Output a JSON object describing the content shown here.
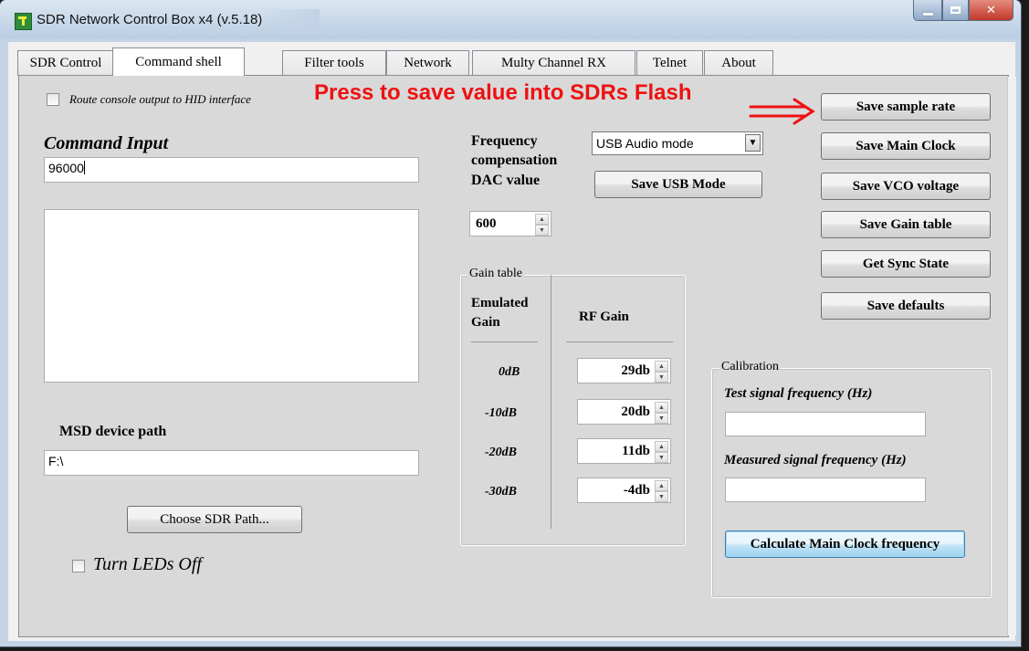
{
  "window": {
    "title": "SDR Network Control Box x4 (v.5.18)",
    "controls": {
      "minimize": "minimize-icon",
      "maximize": "maximize-icon",
      "close": "close-icon"
    }
  },
  "tabs": [
    {
      "label": "SDR Control",
      "active": false
    },
    {
      "label": "Command shell",
      "active": true
    },
    {
      "label": "Filter tools",
      "active": false
    },
    {
      "label": "Network",
      "active": false
    },
    {
      "label": "Multy Channel RX",
      "active": false
    },
    {
      "label": "Telnet",
      "active": false
    },
    {
      "label": "About",
      "active": false
    }
  ],
  "console": {
    "route_label": "Route console output to HID interface",
    "route_checked": false
  },
  "command": {
    "heading": "Command Input",
    "value": "96000",
    "output": ""
  },
  "msd": {
    "heading": "MSD device path",
    "value": "F:\\",
    "choose_button": "Choose SDR Path..."
  },
  "leds": {
    "label": "Turn LEDs Off",
    "checked": false
  },
  "frequency": {
    "label_line1": "Frequency",
    "label_line2": "compensation",
    "label_line3": "DAC value",
    "dac_value": "600",
    "usb_mode_selected": "USB Audio mode",
    "save_usb_mode": "Save USB Mode"
  },
  "gain_table": {
    "title": "Gain table",
    "col_emulated_1": "Emulated",
    "col_emulated_2": "Gain",
    "col_rf": "RF Gain",
    "rows": [
      {
        "emulated": "0dB",
        "rf": "29db"
      },
      {
        "emulated": "-10dB",
        "rf": "20db"
      },
      {
        "emulated": "-20dB",
        "rf": "11db"
      },
      {
        "emulated": "-30dB",
        "rf": "-4db"
      }
    ]
  },
  "annotation": {
    "text": "Press to save value into SDRs Flash",
    "color": "#ee1111"
  },
  "actions": {
    "save_sample_rate": "Save sample rate",
    "save_main_clock": "Save Main Clock",
    "save_vco_voltage": "Save VCO voltage",
    "save_gain_table": "Save Gain table",
    "get_sync_state": "Get Sync State",
    "save_defaults": "Save defaults"
  },
  "calibration": {
    "title": "Calibration",
    "test_label": "Test signal frequency (Hz)",
    "test_value": "",
    "measured_label": "Measured signal frequency (Hz)",
    "measured_value": "",
    "calculate_button": "Calculate Main Clock frequency"
  }
}
